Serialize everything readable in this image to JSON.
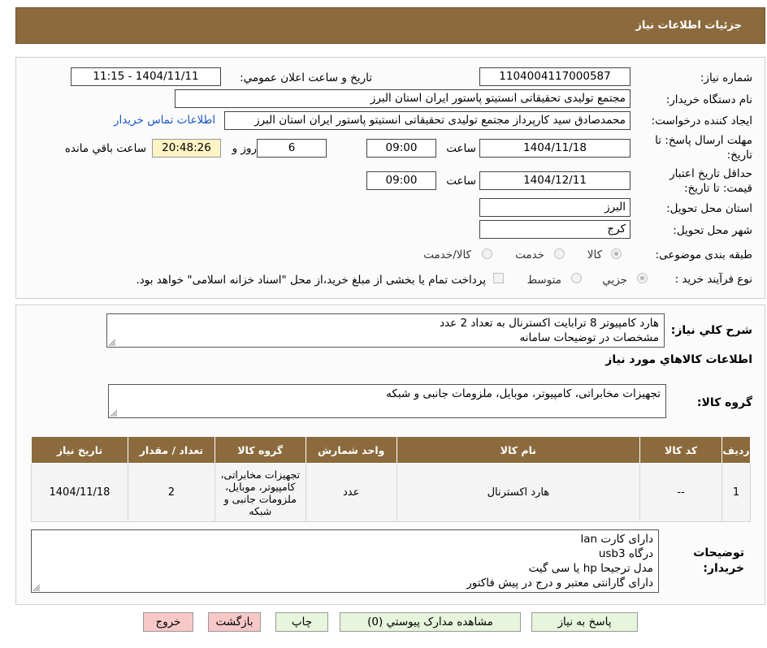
{
  "header": {
    "title": "جزئیات اطلاعات نیاز"
  },
  "form": {
    "need_number_label": "شماره نیاز:",
    "need_number": "1104004117000587",
    "announce_label": "تاریخ و ساعت اعلان عمومي:",
    "announce_value": "1404/11/11 - 11:15",
    "buyer_org_label": "نام دستگاه خریدار:",
    "buyer_org": "مجتمع تولیدی تحقیقاتی انستیتو پاستور ایران استان البرز",
    "requester_label": "ایجاد کننده درخواست:",
    "requester": "محمدصادق سید کارپرداز مجتمع تولیدی تحقیقاتی انستیتو پاستور ایران استان البرز",
    "contact_link": "اطلاعات تماس خریدار",
    "deadline_label_1": "مهلت ارسال پاسخ: تا",
    "deadline_label_2": "تاریخ:",
    "deadline_date": "1404/11/18",
    "time_label": "ساعت",
    "deadline_time": "09:00",
    "days_value": "6",
    "days_and_label": "روز و",
    "remaining_time": "20:48:26",
    "remaining_label": "ساعت باقي مانده",
    "validity_label_1": "حداقل تاریخ اعتبار",
    "validity_label_2": "قیمت: تا تاریخ:",
    "validity_date": "1404/12/11",
    "validity_time": "09:00",
    "province_label": "استان محل تحویل:",
    "province": "البرز",
    "city_label": "شهر محل تحویل:",
    "city": "کرج",
    "category_label": "طبقه بندی موضوعی:",
    "category_options": [
      "کالا",
      "خدمت",
      "کالا/خدمت"
    ],
    "process_label": "نوع فرآیند خرید :",
    "process_options": [
      "جزیي",
      "متوسط"
    ],
    "payment_note": "پرداخت تمام یا بخشی از مبلغ خرید،از محل \"اسناد خزانه اسلامی\" خواهد بود."
  },
  "description": {
    "label": "شرح کلي نیاز:",
    "lines": [
      "هارد کامپیوتر 8 ترابایت اکسترنال به تعداد 2 عدد",
      "مشخصات در توضیحات سامانه"
    ]
  },
  "goods_info": {
    "title": "اطلاعات کالاهاي مورد نیاز",
    "group_label": "گروه کالا:",
    "group_value": "تجهیزات مخابراتی، کامپیوتر، موبایل، ملزومات جانبی و شبکه"
  },
  "table": {
    "headers": [
      "ردیف",
      "کد کالا",
      "نام کالا",
      "واحد شمارش",
      "گروه کالا",
      "تعداد / مقدار",
      "تاریخ نیاز"
    ],
    "row": {
      "index": "1",
      "code": "--",
      "name": "هارد اکسترنال",
      "unit": "عدد",
      "group_lines": [
        "تجهیزات مخابراتی،",
        "کامپیوتر، موبایل،",
        "ملزومات جانبی و",
        "شبکه"
      ],
      "qty": "2",
      "date": "1404/11/18"
    }
  },
  "buyer_notes": {
    "label_1": "توضیحات",
    "label_2": "خریدار:",
    "lines": [
      "دارای کارت lan",
      "درگاه usb3",
      "مدل ترجیحا hp یا سی گیت",
      "دارای گارانتی معتبر و درج در پیش فاکتور"
    ]
  },
  "buttons": {
    "reply": "پاسخ به نیاز",
    "attachments": "مشاهده مدارک پیوستي (0)",
    "print": "چاپ",
    "back": "بازگشت",
    "exit": "خروج"
  },
  "colors": {
    "header_bg": "#8b6b3d",
    "link": "#1a56c4",
    "highlight": "#fdf3c4"
  }
}
